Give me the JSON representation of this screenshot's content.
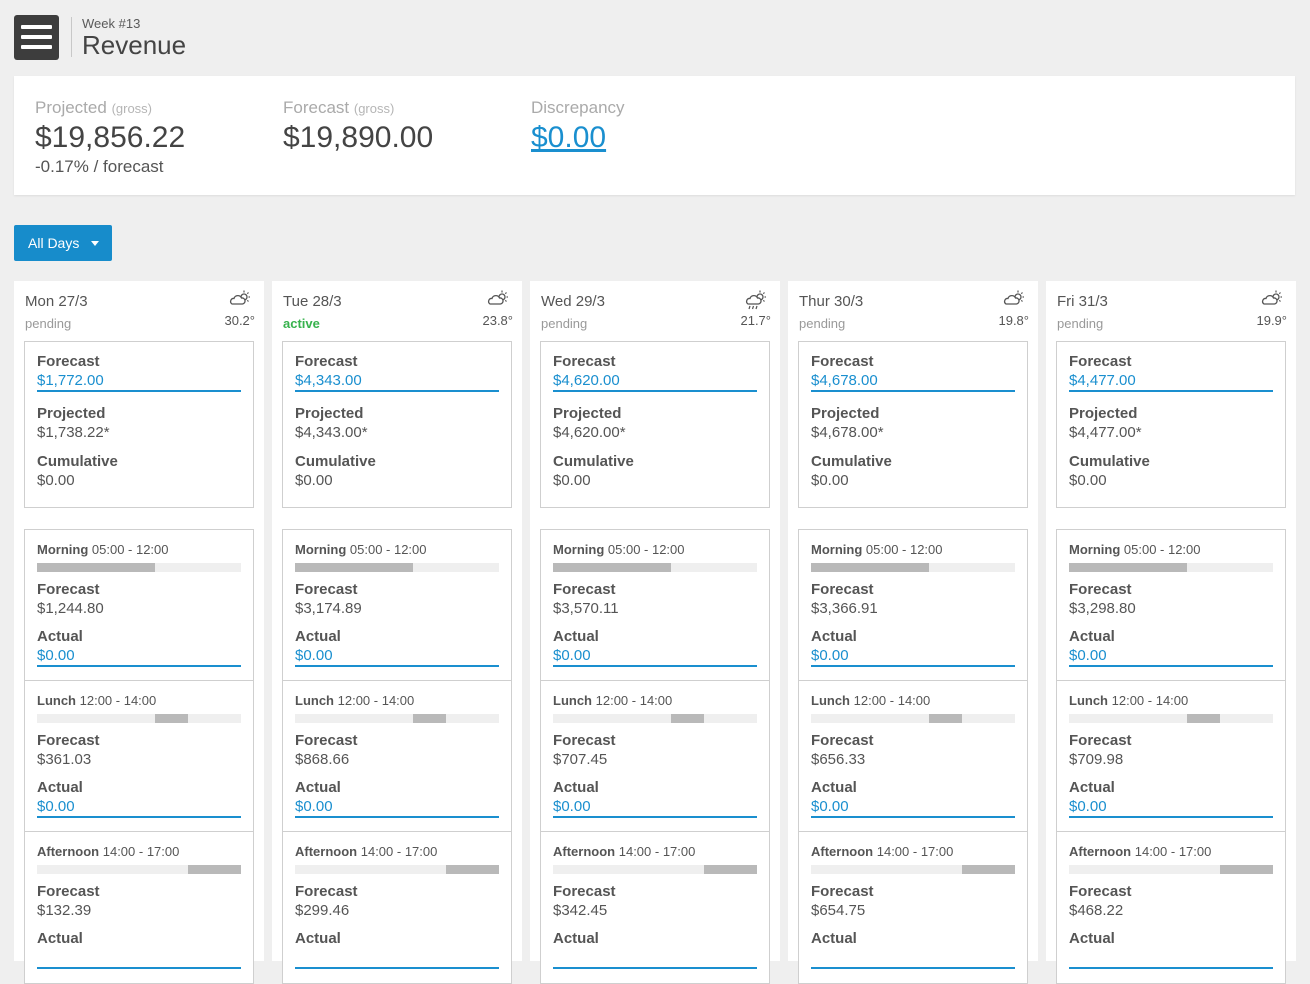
{
  "header": {
    "week_label": "Week #13",
    "title": "Revenue"
  },
  "summary": {
    "projected": {
      "label": "Projected",
      "sublabel": "(gross)",
      "value": "$19,856.22",
      "note": "-0.17% / forecast"
    },
    "forecast": {
      "label": "Forecast",
      "sublabel": "(gross)",
      "value": "$19,890.00"
    },
    "discrepancy": {
      "label": "Discrepancy",
      "value": "$0.00"
    }
  },
  "filter": {
    "label": "All Days"
  },
  "labels": {
    "forecast": "Forecast",
    "projected": "Projected",
    "cumulative": "Cumulative",
    "actual": "Actual",
    "morning": "Morning",
    "lunch": "Lunch",
    "afternoon": "Afternoon",
    "morning_time": "05:00 - 12:00",
    "lunch_time": "12:00 - 14:00",
    "afternoon_time": "14:00 - 17:00"
  },
  "colors": {
    "accent": "#178ccb",
    "active": "#37b24d",
    "bar": "#b9b9b9"
  },
  "timebars": {
    "morning": [
      0.0,
      0.58
    ],
    "lunch": [
      0.58,
      0.74
    ],
    "afternoon": [
      0.74,
      1.0
    ]
  },
  "days": [
    {
      "name": "Mon 27/3",
      "status": "pending",
      "weather_icon": "cloud-sun-icon",
      "temp": "30.2°",
      "forecast": "$1,772.00",
      "projected": "$1,738.22*",
      "cumulative": "$0.00",
      "morning": {
        "forecast": "$1,244.80",
        "actual": "$0.00"
      },
      "lunch": {
        "forecast": "$361.03",
        "actual": "$0.00"
      },
      "afternoon": {
        "forecast": "$132.39",
        "actual": ""
      }
    },
    {
      "name": "Tue 28/3",
      "status": "active",
      "weather_icon": "cloud-sun-icon",
      "temp": "23.8°",
      "forecast": "$4,343.00",
      "projected": "$4,343.00*",
      "cumulative": "$0.00",
      "morning": {
        "forecast": "$3,174.89",
        "actual": "$0.00"
      },
      "lunch": {
        "forecast": "$868.66",
        "actual": "$0.00"
      },
      "afternoon": {
        "forecast": "$299.46",
        "actual": ""
      }
    },
    {
      "name": "Wed 29/3",
      "status": "pending",
      "weather_icon": "cloud-sun-rain-icon",
      "temp": "21.7°",
      "forecast": "$4,620.00",
      "projected": "$4,620.00*",
      "cumulative": "$0.00",
      "morning": {
        "forecast": "$3,570.11",
        "actual": "$0.00"
      },
      "lunch": {
        "forecast": "$707.45",
        "actual": "$0.00"
      },
      "afternoon": {
        "forecast": "$342.45",
        "actual": ""
      }
    },
    {
      "name": "Thur 30/3",
      "status": "pending",
      "weather_icon": "cloud-sun-icon",
      "temp": "19.8°",
      "forecast": "$4,678.00",
      "projected": "$4,678.00*",
      "cumulative": "$0.00",
      "morning": {
        "forecast": "$3,366.91",
        "actual": "$0.00"
      },
      "lunch": {
        "forecast": "$656.33",
        "actual": "$0.00"
      },
      "afternoon": {
        "forecast": "$654.75",
        "actual": ""
      }
    },
    {
      "name": "Fri 31/3",
      "status": "pending",
      "weather_icon": "cloud-sun-icon",
      "temp": "19.9°",
      "forecast": "$4,477.00",
      "projected": "$4,477.00*",
      "cumulative": "$0.00",
      "morning": {
        "forecast": "$3,298.80",
        "actual": "$0.00"
      },
      "lunch": {
        "forecast": "$709.98",
        "actual": "$0.00"
      },
      "afternoon": {
        "forecast": "$468.22",
        "actual": ""
      }
    }
  ]
}
